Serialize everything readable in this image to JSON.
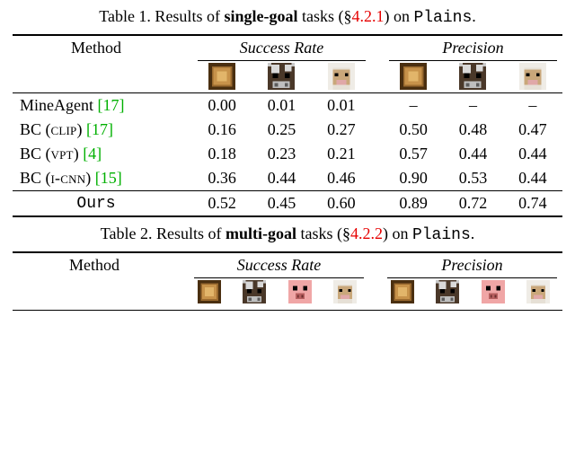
{
  "table1": {
    "caption_prefix": "Table 1. Results of ",
    "caption_bold": "single-goal",
    "caption_mid": " tasks (§",
    "caption_sec": "4.2.1",
    "caption_mid2": ") on ",
    "caption_env": "Plains",
    "caption_end": ".",
    "header_method": "Method",
    "group_sr": "Success Rate",
    "group_pr": "Precision",
    "icons": [
      "log-icon",
      "cow-icon",
      "sheep-icon"
    ],
    "rows": [
      {
        "method": "MineAgent",
        "cite": "[17]",
        "sr": [
          "0.00",
          "0.01",
          "0.01"
        ],
        "pr": [
          "–",
          "–",
          "–"
        ]
      },
      {
        "method_pre": "BC (",
        "method_sc": "clip",
        "method_post": ")",
        "cite": "[17]",
        "sr": [
          "0.16",
          "0.25",
          "0.27"
        ],
        "pr": [
          "0.50",
          "0.48",
          "0.47"
        ]
      },
      {
        "method_pre": "BC (",
        "method_sc": "vpt",
        "method_post": ")",
        "cite": "[4]",
        "sr": [
          "0.18",
          "0.23",
          "0.21"
        ],
        "pr": [
          "0.57",
          "0.44",
          "0.44"
        ]
      },
      {
        "method_pre": "BC (",
        "method_sc": "i-cnn",
        "method_post": ")",
        "cite": "[15]",
        "sr": [
          "0.36",
          "0.44",
          "0.46"
        ],
        "pr_bold": [
          true,
          false,
          false
        ],
        "pr": [
          "0.90",
          "0.53",
          "0.44"
        ]
      }
    ],
    "ours_label": "Ours",
    "ours_sr": [
      "0.52",
      "0.45",
      "0.60"
    ],
    "ours_sr_bold": [
      true,
      true,
      true
    ],
    "ours_pr": [
      "0.89",
      "0.72",
      "0.74"
    ],
    "ours_pr_bold": [
      false,
      true,
      true
    ]
  },
  "table2": {
    "caption_prefix": "Table 2. Results of ",
    "caption_bold": "multi-goal",
    "caption_mid": " tasks (§",
    "caption_sec": "4.2.2",
    "caption_mid2": ") on ",
    "caption_env": "Plains",
    "caption_end": ".",
    "header_method": "Method",
    "group_sr": "Success Rate",
    "group_pr": "Precision",
    "icons": [
      "log-icon",
      "cow-icon",
      "pig-icon",
      "sheep-icon"
    ]
  },
  "chart_data": [
    {
      "type": "table",
      "title": "Table 1. Results of single-goal tasks (§4.2.1) on Plains.",
      "columns_group": [
        "Success Rate",
        "Precision"
      ],
      "column_icons": [
        "log",
        "cow",
        "sheep"
      ],
      "rows": [
        {
          "method": "MineAgent [17]",
          "success_rate": {
            "log": 0.0,
            "cow": 0.01,
            "sheep": 0.01
          },
          "precision": {
            "log": null,
            "cow": null,
            "sheep": null
          }
        },
        {
          "method": "BC (CLIP) [17]",
          "success_rate": {
            "log": 0.16,
            "cow": 0.25,
            "sheep": 0.27
          },
          "precision": {
            "log": 0.5,
            "cow": 0.48,
            "sheep": 0.47
          }
        },
        {
          "method": "BC (VPT) [4]",
          "success_rate": {
            "log": 0.18,
            "cow": 0.23,
            "sheep": 0.21
          },
          "precision": {
            "log": 0.57,
            "cow": 0.44,
            "sheep": 0.44
          }
        },
        {
          "method": "BC (I-CNN) [15]",
          "success_rate": {
            "log": 0.36,
            "cow": 0.44,
            "sheep": 0.46
          },
          "precision": {
            "log": 0.9,
            "cow": 0.53,
            "sheep": 0.44
          }
        },
        {
          "method": "Ours",
          "success_rate": {
            "log": 0.52,
            "cow": 0.45,
            "sheep": 0.6
          },
          "precision": {
            "log": 0.89,
            "cow": 0.72,
            "sheep": 0.74
          }
        }
      ],
      "bold_best": {
        "success_rate": {
          "log": "Ours",
          "cow": "Ours",
          "sheep": "Ours"
        },
        "precision": {
          "log": "BC (I-CNN) [15]",
          "cow": "Ours",
          "sheep": "Ours"
        }
      }
    },
    {
      "type": "table",
      "title": "Table 2. Results of multi-goal tasks (§4.2.2) on Plains.",
      "columns_group": [
        "Success Rate",
        "Precision"
      ],
      "column_icons": [
        "log",
        "cow",
        "pig",
        "sheep"
      ],
      "rows": []
    }
  ]
}
